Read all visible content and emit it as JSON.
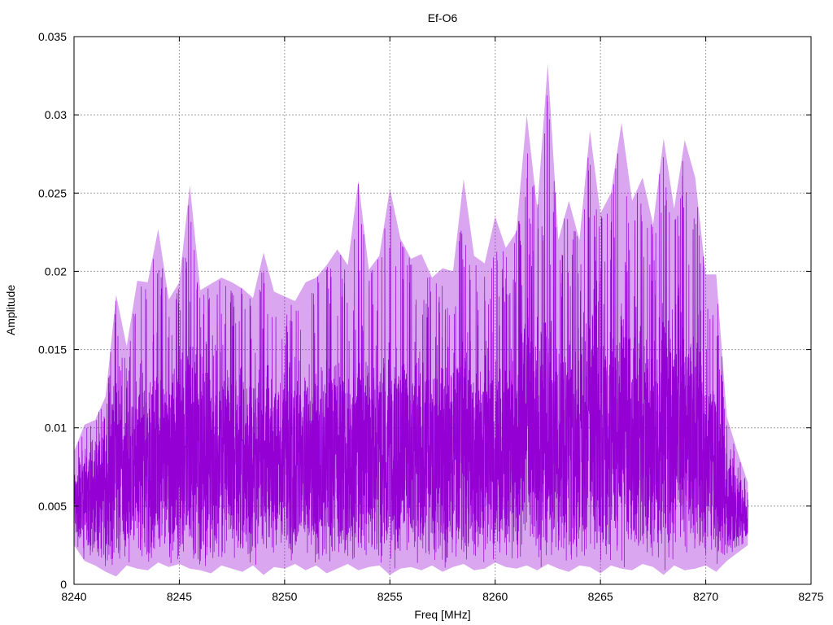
{
  "chart_data": {
    "type": "line",
    "title": "Ef-O6",
    "xlabel": "Freq [MHz]",
    "ylabel": "Amplitude",
    "xlim": [
      8240,
      8275
    ],
    "ylim": [
      0,
      0.035
    ],
    "xticks": [
      "8240",
      "8245",
      "8250",
      "8255",
      "8260",
      "8265",
      "8270",
      "8275"
    ],
    "yticks": [
      "0",
      "0.005",
      "0.01",
      "0.015",
      "0.02",
      "0.025",
      "0.03",
      "0.035"
    ],
    "grid": true,
    "legend": "none",
    "series": [
      {
        "color": "#9400d3",
        "x": [
          8240.0,
          8240.5,
          8241.0,
          8241.5,
          8242.0,
          8242.5,
          8243.0,
          8243.5,
          8244.0,
          8244.5,
          8245.0,
          8245.5,
          8246.0,
          8246.5,
          8247.0,
          8247.5,
          8248.0,
          8248.5,
          8249.0,
          8249.5,
          8250.0,
          8250.5,
          8251.0,
          8251.5,
          8252.0,
          8252.5,
          8253.0,
          8253.5,
          8254.0,
          8254.5,
          8255.0,
          8255.5,
          8256.0,
          8256.5,
          8257.0,
          8257.5,
          8258.0,
          8258.5,
          8259.0,
          8259.5,
          8260.0,
          8260.5,
          8261.0,
          8261.5,
          8262.0,
          8262.5,
          8263.0,
          8263.5,
          8264.0,
          8264.5,
          8265.0,
          8265.5,
          8266.0,
          8266.5,
          8267.0,
          8267.5,
          8268.0,
          8268.5,
          8269.0,
          8269.5,
          8270.0,
          8270.5,
          8271.0,
          8271.5,
          8272.0
        ],
        "ymax": [
          0.0085,
          0.0102,
          0.0105,
          0.012,
          0.0185,
          0.0152,
          0.0194,
          0.0193,
          0.0227,
          0.0182,
          0.0193,
          0.0255,
          0.0188,
          0.0192,
          0.0196,
          0.0193,
          0.0189,
          0.0183,
          0.0212,
          0.0187,
          0.0184,
          0.0181,
          0.0193,
          0.0196,
          0.0204,
          0.0214,
          0.0204,
          0.0258,
          0.0201,
          0.021,
          0.0253,
          0.0221,
          0.0208,
          0.0211,
          0.0196,
          0.0202,
          0.02,
          0.0259,
          0.021,
          0.0205,
          0.0235,
          0.0215,
          0.0225,
          0.03,
          0.024,
          0.0333,
          0.022,
          0.0245,
          0.022,
          0.029,
          0.0237,
          0.025,
          0.0295,
          0.0245,
          0.026,
          0.023,
          0.0285,
          0.024,
          0.0284,
          0.026,
          0.0198,
          0.0198,
          0.0107,
          0.0085,
          0.0065
        ],
        "ymin": [
          0.0025,
          0.0015,
          0.0012,
          0.0008,
          0.0005,
          0.0012,
          0.001,
          0.0009,
          0.0014,
          0.0011,
          0.0013,
          0.001,
          0.0009,
          0.0007,
          0.0012,
          0.001,
          0.0008,
          0.0012,
          0.0006,
          0.0011,
          0.001,
          0.0013,
          0.0009,
          0.0012,
          0.0007,
          0.001,
          0.0013,
          0.0009,
          0.0011,
          0.0012,
          0.0006,
          0.001,
          0.0011,
          0.0009,
          0.0012,
          0.0008,
          0.0011,
          0.0013,
          0.0009,
          0.001,
          0.0014,
          0.0011,
          0.001,
          0.0012,
          0.0009,
          0.0013,
          0.001,
          0.0008,
          0.0012,
          0.0011,
          0.0007,
          0.0012,
          0.001,
          0.0009,
          0.0013,
          0.0011,
          0.0006,
          0.0012,
          0.0009,
          0.001,
          0.0012,
          0.0008,
          0.0015,
          0.002,
          0.0025
        ]
      }
    ]
  }
}
